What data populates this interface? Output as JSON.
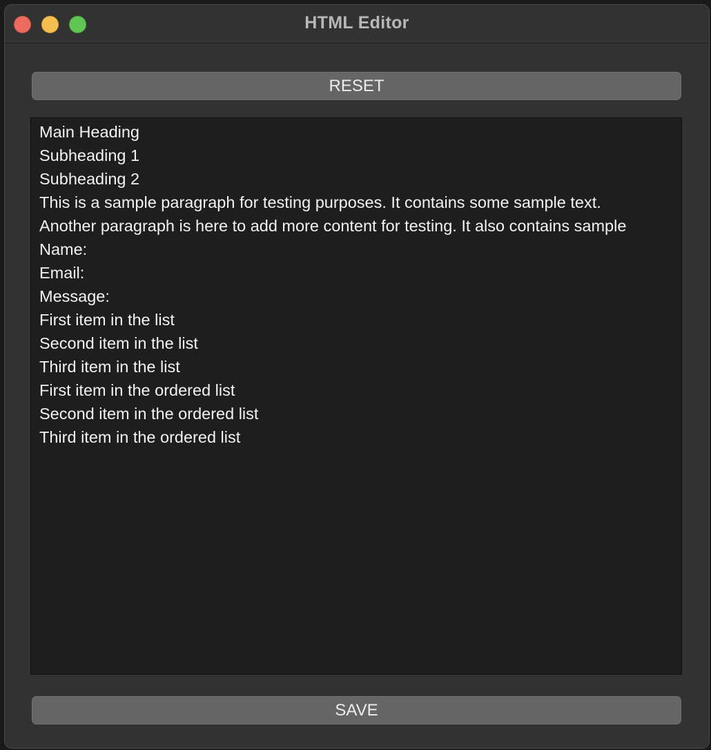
{
  "window": {
    "title": "HTML Editor"
  },
  "toolbar": {
    "reset_label": "RESET",
    "save_label": "SAVE"
  },
  "editor": {
    "lines": [
      "Main Heading",
      "Subheading 1",
      "Subheading 2",
      "This is a sample paragraph for testing purposes. It contains some sample text.",
      "Another paragraph is here to add more content for testing. It also contains sample",
      "Name:",
      "Email:",
      "Message:",
      "First item in the list",
      "Second item in the list",
      "Third item in the list",
      "First item in the ordered list",
      "Second item in the ordered list",
      "Third item in the ordered list"
    ]
  },
  "colors": {
    "close": "#ed6a5e",
    "minimize": "#f5bf4f",
    "maximize": "#61c554",
    "window_bg": "#323232",
    "editor_bg": "#1e1e1e",
    "button_bg": "#656565"
  }
}
